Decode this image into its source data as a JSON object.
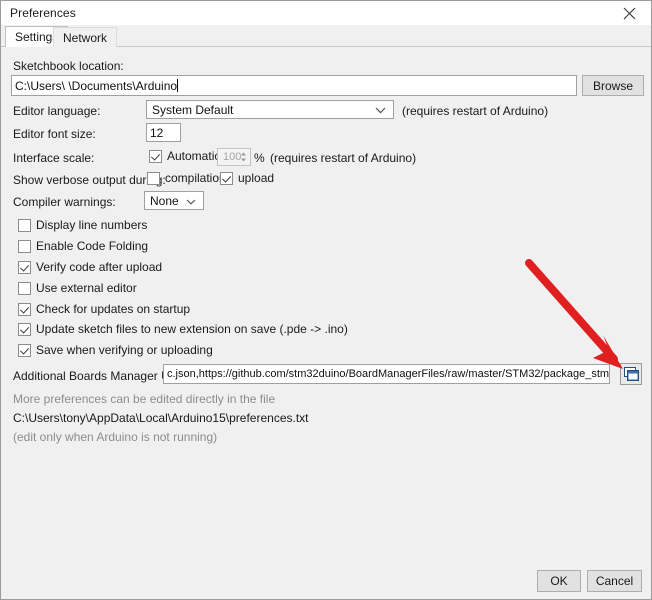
{
  "window": {
    "title": "Preferences",
    "close_label": "✕"
  },
  "tabs": [
    {
      "label": "Settings",
      "active": true
    },
    {
      "label": "Network",
      "active": false
    }
  ],
  "settings": {
    "sketchbook": {
      "label": "Sketchbook location:",
      "value": "C:\\Users\\      \\Documents\\Arduino",
      "browse_label": "Browse"
    },
    "editor_language": {
      "label": "Editor language:",
      "value": "System Default",
      "note": "(requires restart of Arduino)"
    },
    "editor_font_size": {
      "label": "Editor font size:",
      "value": "12"
    },
    "interface_scale": {
      "label": "Interface scale:",
      "automatic_label": "Automatic",
      "automatic_checked": true,
      "scale_value": "100",
      "percent_label": "%",
      "note": "(requires restart of Arduino)"
    },
    "verbose_output": {
      "label": "Show verbose output during:",
      "compilation_label": "compilation",
      "compilation_checked": false,
      "upload_label": "upload",
      "upload_checked": true
    },
    "compiler_warnings": {
      "label": "Compiler warnings:",
      "value": "None"
    },
    "checkboxes": [
      {
        "label": "Display line numbers",
        "checked": false
      },
      {
        "label": "Enable Code Folding",
        "checked": false
      },
      {
        "label": "Verify code after upload",
        "checked": true
      },
      {
        "label": "Use external editor",
        "checked": false
      },
      {
        "label": "Check for updates on startup",
        "checked": true
      },
      {
        "label": "Update sketch files to new extension on save (.pde -> .ino)",
        "checked": true
      },
      {
        "label": "Save when verifying or uploading",
        "checked": true
      }
    ],
    "boards_manager": {
      "label": "Additional Boards Manager URLs:",
      "value": "c.json,https://github.com/stm32duino/BoardManagerFiles/raw/master/STM32/package_stm_index.json",
      "edit_icon": "window-list-icon"
    },
    "more_prefs": {
      "line1": "More preferences can be edited directly in the file",
      "line2": "C:\\Users\\tony\\AppData\\Local\\Arduino15\\preferences.txt",
      "line3": "(edit only when Arduino is not running)"
    }
  },
  "footer": {
    "ok_label": "OK",
    "cancel_label": "Cancel"
  },
  "annotation": {
    "type": "red-arrow",
    "color": "#e02020",
    "points_to": "boards-manager-edit-button"
  }
}
